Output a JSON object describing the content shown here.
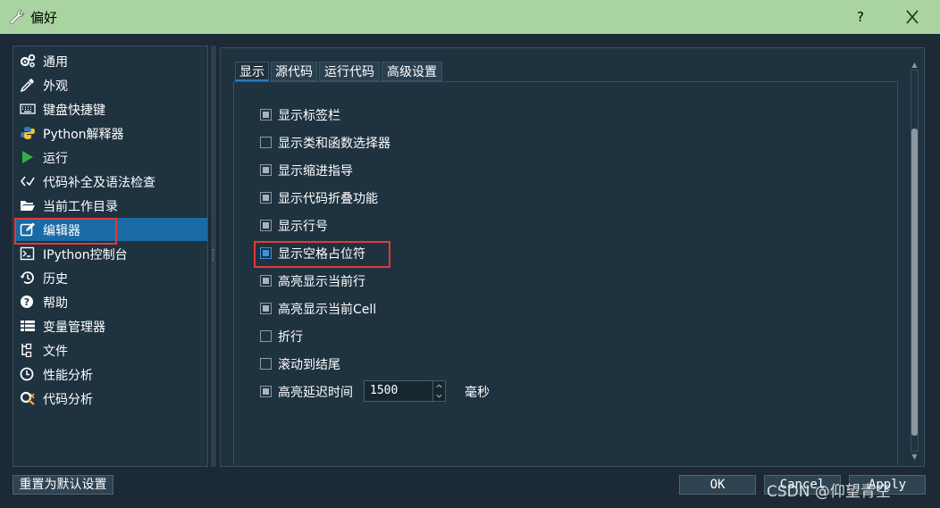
{
  "window": {
    "title": "偏好",
    "help_symbol": "?"
  },
  "nav": {
    "items": [
      {
        "label": "通用",
        "icon": "gears-icon"
      },
      {
        "label": "外观",
        "icon": "eyedropper-icon"
      },
      {
        "label": "键盘快捷键",
        "icon": "keyboard-icon"
      },
      {
        "label": "Python解释器",
        "icon": "python-icon"
      },
      {
        "label": "运行",
        "icon": "play-icon"
      },
      {
        "label": "代码补全及语法检查",
        "icon": "code-check-icon"
      },
      {
        "label": "当前工作目录",
        "icon": "folder-open-icon"
      },
      {
        "label": "编辑器",
        "icon": "edit-icon",
        "selected": true
      },
      {
        "label": "IPython控制台",
        "icon": "terminal-icon"
      },
      {
        "label": "历史",
        "icon": "history-icon"
      },
      {
        "label": "帮助",
        "icon": "question-circle-icon"
      },
      {
        "label": "变量管理器",
        "icon": "table-list-icon"
      },
      {
        "label": "文件",
        "icon": "file-tree-icon"
      },
      {
        "label": "性能分析",
        "icon": "clock-icon"
      },
      {
        "label": "代码分析",
        "icon": "code-analysis-icon"
      }
    ]
  },
  "tabs": [
    {
      "label": "显示",
      "active": true
    },
    {
      "label": "源代码"
    },
    {
      "label": "运行代码"
    },
    {
      "label": "高级设置"
    }
  ],
  "options": [
    {
      "label": "显示标签栏",
      "checked": true
    },
    {
      "label": "显示类和函数选择器",
      "checked": false
    },
    {
      "label": "显示缩进指导",
      "checked": true
    },
    {
      "label": "显示代码折叠功能",
      "checked": true
    },
    {
      "label": "显示行号",
      "checked": true
    },
    {
      "label": "显示空格占位符",
      "checked": true,
      "focused": true
    },
    {
      "label": "高亮显示当前行",
      "checked": true
    },
    {
      "label": "高亮显示当前Cell",
      "checked": true
    },
    {
      "label": "折行",
      "checked": false
    },
    {
      "label": "滚动到结尾",
      "checked": false
    },
    {
      "label": "高亮延迟时间",
      "checked": true,
      "value": "1500",
      "unit": "毫秒"
    }
  ],
  "buttons": {
    "reset": "重置为默认设置",
    "ok": "OK",
    "cancel": "Cancel",
    "apply": "Apply"
  },
  "watermark": "CSDN @仰望青空",
  "colors": {
    "titlebar": "#a9d3a0",
    "panel": "#1f3240",
    "selection": "#1a6aa6",
    "highlight_box": "#e03a3a",
    "focus": "#3a93e0"
  }
}
